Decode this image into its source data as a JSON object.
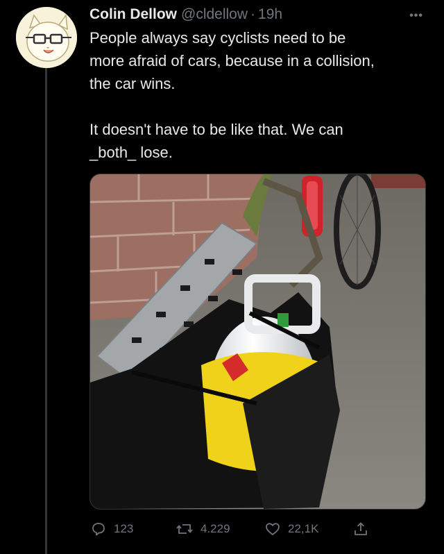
{
  "tweet": {
    "author_name": "Colin Dellow",
    "handle": "@cldellow",
    "separator": "·",
    "time": "19h",
    "text": "People always say cyclists need to be\nmore afraid of cars, because in a collision,\nthe car wins.\n\nIt doesn't have to be like that. We can\n_both_ lose."
  },
  "menu": {
    "more_icon": "more-horizontal-icon",
    "more_label": "•••"
  },
  "actions": {
    "replies": "123",
    "retweets": "4.229",
    "likes": "22,1K"
  },
  "icons": [
    "reply-icon",
    "retweet-icon",
    "like-icon",
    "share-icon"
  ],
  "colors": {
    "background": "#000000",
    "text": "#e7e9ea",
    "secondary": "#71767b"
  }
}
